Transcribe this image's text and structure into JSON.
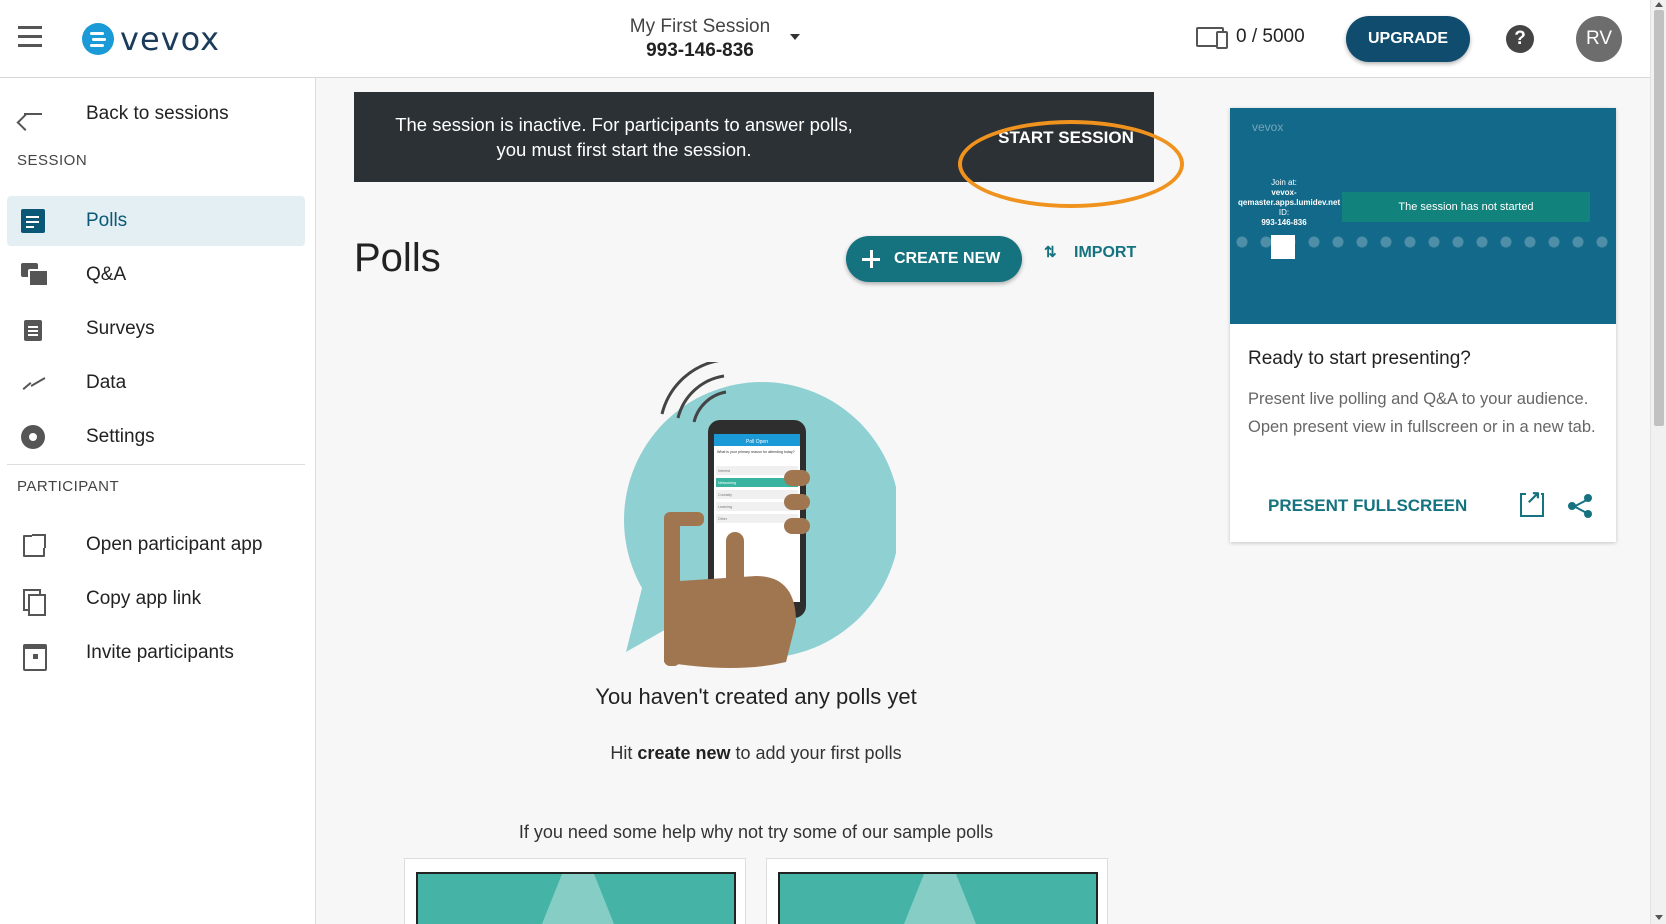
{
  "header": {
    "brand": "vevox",
    "session_name": "My First Session",
    "session_id": "993-146-836",
    "participant_count": "0 / 5000",
    "upgrade_label": "UPGRADE",
    "help_label": "?",
    "avatar_initials": "RV"
  },
  "sidebar": {
    "back_label": "Back to sessions",
    "session_section": "SESSION",
    "session_items": [
      {
        "label": "Polls",
        "icon": "polls-icon",
        "active": true
      },
      {
        "label": "Q&A",
        "icon": "qa-icon"
      },
      {
        "label": "Surveys",
        "icon": "surveys-icon"
      },
      {
        "label": "Data",
        "icon": "data-icon"
      },
      {
        "label": "Settings",
        "icon": "settings-icon"
      }
    ],
    "participant_section": "PARTICIPANT",
    "participant_items": [
      {
        "label": "Open participant app",
        "icon": "open-external-icon"
      },
      {
        "label": "Copy app link",
        "icon": "copy-icon"
      },
      {
        "label": "Invite participants",
        "icon": "calendar-icon"
      }
    ]
  },
  "banner": {
    "message": "The session is inactive. For participants to answer polls, you must first start the session.",
    "action_label": "START SESSION"
  },
  "main": {
    "title": "Polls",
    "create_label": "CREATE NEW",
    "import_label": "IMPORT",
    "empty_title": "You haven't created any polls yet",
    "hint_prefix": "Hit",
    "hint_bold": "create new",
    "hint_suffix": "to add your first polls",
    "sample_title": "If you need some help why not try some of our sample polls"
  },
  "illustration": {
    "phone_header": "Poll Open",
    "phone_question": "What is your primary reason for attending today?",
    "phone_options": [
      "Interest",
      "Networking",
      "Curiosity",
      "Learning",
      "Other"
    ]
  },
  "present": {
    "preview_brand": "vevox",
    "preview_join_label": "Join at:",
    "preview_join_url": "vevox-qemaster.apps.lumidev.net",
    "preview_id_label": "ID:",
    "preview_id": "993-146-836",
    "preview_status": "The session has not started",
    "title": "Ready to start presenting?",
    "description": "Present live polling and Q&A to your audience. Open present view in fullscreen or in a new tab.",
    "fullscreen_label": "PRESENT FULLSCREEN"
  },
  "colors": {
    "brand_dark": "#0f4c6e",
    "accent_teal": "#15727f",
    "banner_bg": "#2b3135",
    "highlight_ring": "#f0921e",
    "active_nav_bg": "#e3eff3"
  }
}
